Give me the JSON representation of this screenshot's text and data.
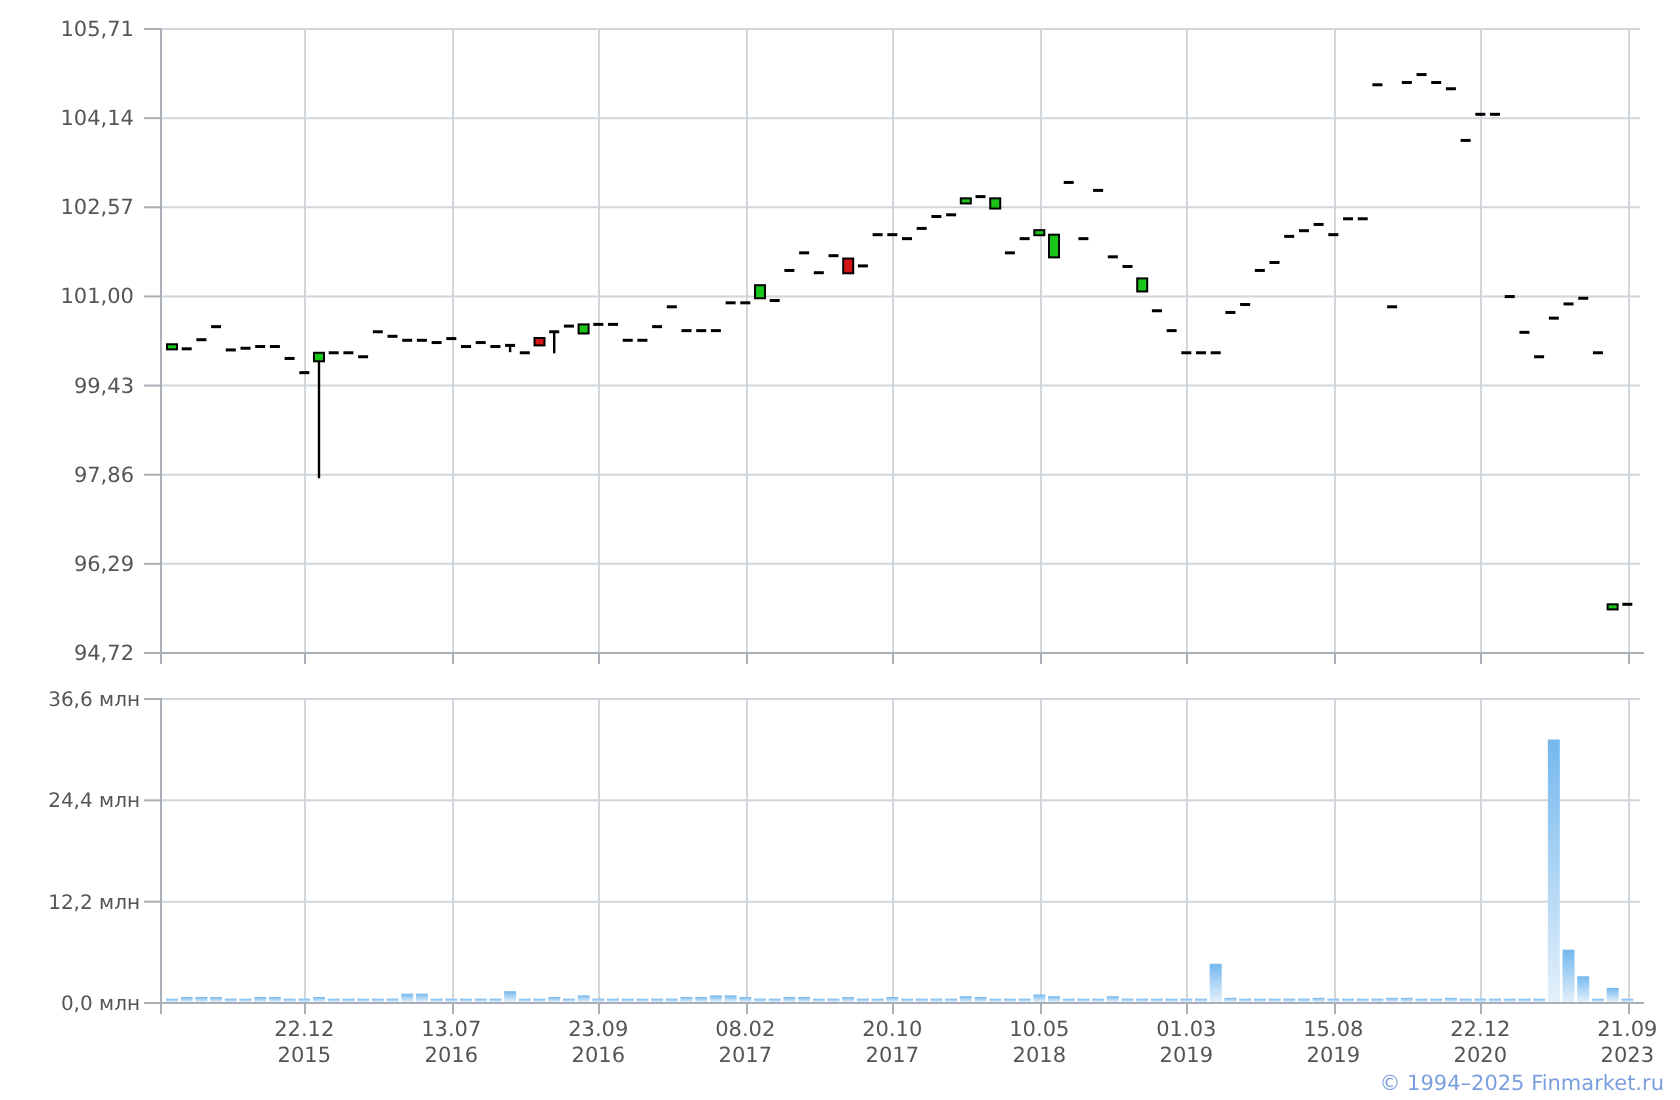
{
  "price_chart": {
    "chart_data": {
      "type": "candlestick",
      "grid": true,
      "categories": [
        null,
        null,
        null,
        null,
        null,
        null,
        null,
        null,
        null,
        null,
        null,
        null,
        null,
        null,
        null,
        null,
        null,
        null,
        null,
        null,
        null,
        null,
        null,
        null,
        null,
        null,
        null,
        null,
        null,
        null,
        null,
        null,
        null,
        null,
        null,
        null,
        null,
        null,
        null,
        null,
        null,
        null,
        null,
        null,
        null,
        null,
        null,
        null,
        null,
        null,
        null,
        null,
        null,
        null,
        null,
        null,
        null,
        null,
        null,
        null,
        null,
        null,
        null,
        null,
        null,
        null,
        null,
        null,
        null,
        null,
        null,
        null,
        null,
        null,
        null,
        null,
        null,
        null,
        null,
        null,
        null,
        null,
        null,
        null,
        null,
        null,
        null,
        null,
        null,
        null,
        null,
        null,
        null,
        null,
        null,
        null,
        null,
        null,
        null,
        null
      ],
      "ylim": [
        94.72,
        105.71
      ],
      "yticks": [
        {
          "value": 94.72,
          "label": "94,72"
        },
        {
          "value": 96.29,
          "label": "96,29"
        },
        {
          "value": 97.86,
          "label": "97,86"
        },
        {
          "value": 99.43,
          "label": "99,43"
        },
        {
          "value": 101.0,
          "label": "101,00"
        },
        {
          "value": 102.57,
          "label": "102,57"
        },
        {
          "value": 104.14,
          "label": "104,14"
        },
        {
          "value": 105.71,
          "label": "105,71"
        }
      ],
      "ohlc": [
        [
          100.05,
          100.14,
          100.05,
          100.14
        ],
        [
          100.06,
          100.06,
          100.06,
          100.06
        ],
        [
          100.22,
          100.22,
          100.22,
          100.22
        ],
        [
          100.45,
          100.45,
          100.45,
          100.45
        ],
        [
          100.04,
          100.04,
          100.04,
          100.04
        ],
        [
          100.07,
          100.07,
          100.07,
          100.07
        ],
        [
          100.1,
          100.1,
          100.1,
          100.1
        ],
        [
          100.1,
          100.1,
          100.1,
          100.1
        ],
        [
          99.89,
          99.89,
          99.89,
          99.89
        ],
        [
          99.64,
          99.64,
          99.64,
          99.64
        ],
        [
          99.84,
          99.99,
          97.78,
          99.99
        ],
        [
          99.99,
          99.99,
          99.99,
          99.99
        ],
        [
          99.99,
          99.99,
          99.99,
          99.99
        ],
        [
          99.92,
          99.92,
          99.92,
          99.92
        ],
        [
          100.36,
          100.36,
          100.36,
          100.36
        ],
        [
          100.28,
          100.28,
          100.28,
          100.28
        ],
        [
          100.21,
          100.21,
          100.21,
          100.21
        ],
        [
          100.21,
          100.21,
          100.21,
          100.21
        ],
        [
          100.17,
          100.17,
          100.17,
          100.17
        ],
        [
          100.24,
          100.24,
          100.24,
          100.24
        ],
        [
          100.1,
          100.1,
          100.1,
          100.1
        ],
        [
          100.17,
          100.17,
          100.17,
          100.17
        ],
        [
          100.1,
          100.1,
          100.1,
          100.1
        ],
        [
          100.12,
          100.12,
          100.0,
          100.12
        ],
        [
          99.99,
          99.99,
          99.99,
          99.99
        ],
        [
          100.25,
          100.25,
          100.12,
          100.12
        ],
        [
          100.36,
          100.36,
          99.98,
          100.36
        ],
        [
          100.46,
          100.46,
          100.46,
          100.46
        ],
        [
          100.33,
          100.49,
          100.33,
          100.49
        ],
        [
          100.49,
          100.49,
          100.49,
          100.49
        ],
        [
          100.49,
          100.49,
          100.49,
          100.49
        ],
        [
          100.21,
          100.21,
          100.21,
          100.21
        ],
        [
          100.21,
          100.21,
          100.21,
          100.21
        ],
        [
          100.45,
          100.45,
          100.45,
          100.45
        ],
        [
          100.8,
          100.8,
          100.8,
          100.8
        ],
        [
          100.38,
          100.38,
          100.38,
          100.38
        ],
        [
          100.38,
          100.38,
          100.38,
          100.38
        ],
        [
          100.38,
          100.38,
          100.38,
          100.38
        ],
        [
          100.87,
          100.87,
          100.87,
          100.87
        ],
        [
          100.87,
          100.87,
          100.87,
          100.87
        ],
        [
          100.95,
          101.18,
          100.95,
          101.18
        ],
        [
          100.91,
          100.91,
          100.91,
          100.91
        ],
        [
          101.44,
          101.44,
          101.44,
          101.44
        ],
        [
          101.75,
          101.75,
          101.75,
          101.75
        ],
        [
          101.4,
          101.4,
          101.4,
          101.4
        ],
        [
          101.7,
          101.7,
          101.7,
          101.7
        ],
        [
          101.65,
          101.65,
          101.39,
          101.39
        ],
        [
          101.52,
          101.52,
          101.52,
          101.52
        ],
        [
          102.07,
          102.07,
          102.07,
          102.07
        ],
        [
          102.07,
          102.07,
          102.07,
          102.07
        ],
        [
          102.0,
          102.0,
          102.0,
          102.0
        ],
        [
          102.18,
          102.18,
          102.18,
          102.18
        ],
        [
          102.39,
          102.39,
          102.39,
          102.39
        ],
        [
          102.42,
          102.42,
          102.42,
          102.42
        ],
        [
          102.62,
          102.71,
          102.62,
          102.71
        ],
        [
          102.74,
          102.74,
          102.74,
          102.74
        ],
        [
          102.53,
          102.71,
          102.53,
          102.71
        ],
        [
          101.75,
          101.75,
          101.75,
          101.75
        ],
        [
          102.0,
          102.0,
          102.0,
          102.0
        ],
        [
          102.06,
          102.15,
          102.06,
          102.15
        ],
        [
          101.67,
          102.07,
          101.67,
          102.07
        ],
        [
          102.99,
          102.99,
          102.99,
          102.99
        ],
        [
          102.0,
          102.0,
          102.0,
          102.0
        ],
        [
          102.85,
          102.85,
          102.85,
          102.85
        ],
        [
          101.68,
          101.68,
          101.68,
          101.68
        ],
        [
          101.51,
          101.51,
          101.51,
          101.51
        ],
        [
          101.07,
          101.3,
          101.07,
          101.3
        ],
        [
          100.73,
          100.73,
          100.73,
          100.73
        ],
        [
          100.38,
          100.38,
          100.38,
          100.38
        ],
        [
          99.99,
          99.99,
          99.99,
          99.99
        ],
        [
          99.99,
          99.99,
          99.99,
          99.99
        ],
        [
          99.99,
          99.99,
          99.99,
          99.99
        ],
        [
          100.7,
          100.7,
          100.7,
          100.7
        ],
        [
          100.84,
          100.84,
          100.84,
          100.84
        ],
        [
          101.44,
          101.44,
          101.44,
          101.44
        ],
        [
          101.58,
          101.58,
          101.58,
          101.58
        ],
        [
          102.04,
          102.04,
          102.04,
          102.04
        ],
        [
          102.14,
          102.14,
          102.14,
          102.14
        ],
        [
          102.25,
          102.25,
          102.25,
          102.25
        ],
        [
          102.07,
          102.07,
          102.07,
          102.07
        ],
        [
          102.35,
          102.35,
          102.35,
          102.35
        ],
        [
          102.35,
          102.35,
          102.35,
          102.35
        ],
        [
          104.71,
          104.71,
          104.71,
          104.71
        ],
        [
          100.8,
          100.8,
          100.8,
          100.8
        ],
        [
          104.75,
          104.75,
          104.75,
          104.75
        ],
        [
          104.89,
          104.89,
          104.89,
          104.89
        ],
        [
          104.75,
          104.75,
          104.75,
          104.75
        ],
        [
          104.64,
          104.64,
          104.64,
          104.64
        ],
        [
          103.73,
          103.73,
          103.73,
          103.73
        ],
        [
          104.19,
          104.19,
          104.19,
          104.19
        ],
        [
          104.19,
          104.19,
          104.19,
          104.19
        ],
        [
          100.98,
          100.98,
          100.98,
          100.98
        ],
        [
          100.35,
          100.35,
          100.35,
          100.35
        ],
        [
          99.92,
          99.92,
          99.92,
          99.92
        ],
        [
          100.6,
          100.6,
          100.6,
          100.6
        ],
        [
          100.85,
          100.85,
          100.85,
          100.85
        ],
        [
          100.95,
          100.95,
          100.95,
          100.95
        ],
        [
          99.99,
          99.99,
          99.99,
          99.99
        ],
        [
          95.47,
          95.56,
          95.47,
          95.56
        ],
        [
          95.56,
          95.56,
          95.56,
          95.56
        ]
      ]
    }
  },
  "volume_chart": {
    "chart_data": {
      "type": "bar",
      "grid": true,
      "ylim": [
        0,
        36.6
      ],
      "categories": [
        null,
        null,
        null,
        null,
        null,
        null,
        null,
        null,
        null,
        "22.12\n2015",
        null,
        null,
        null,
        null,
        null,
        null,
        null,
        null,
        null,
        "13.07\n2016",
        null,
        null,
        null,
        null,
        null,
        null,
        null,
        null,
        null,
        "23.09\n2016",
        null,
        null,
        null,
        null,
        null,
        null,
        null,
        null,
        null,
        "08.02\n2017",
        null,
        null,
        null,
        null,
        null,
        null,
        null,
        null,
        null,
        "20.10\n2017",
        null,
        null,
        null,
        null,
        null,
        null,
        null,
        null,
        null,
        "10.05\n2018",
        null,
        null,
        null,
        null,
        null,
        null,
        null,
        null,
        null,
        "01.03\n2019",
        null,
        null,
        null,
        null,
        null,
        null,
        null,
        null,
        null,
        "15.08\n2019",
        null,
        null,
        null,
        null,
        null,
        null,
        null,
        null,
        null,
        "22.12\n2020",
        null,
        null,
        null,
        null,
        null,
        null,
        null,
        null,
        null,
        "21.09\n2023"
      ],
      "yticks": [
        {
          "value": 0,
          "label": "0,0 млн"
        },
        {
          "value": 12.2,
          "label": "12,2 млн"
        },
        {
          "value": 24.4,
          "label": "24,4 млн"
        },
        {
          "value": 36.6,
          "label": "36,6 млн"
        }
      ],
      "series": [
        {
          "color": "#74b8ee",
          "values": [
            0.4,
            0.6,
            0.6,
            0.6,
            0.4,
            0.4,
            0.6,
            0.6,
            0.4,
            0.4,
            0.6,
            0.4,
            0.4,
            0.4,
            0.4,
            0.4,
            1.0,
            1.0,
            0.4,
            0.4,
            0.4,
            0.4,
            0.4,
            1.3,
            0.4,
            0.4,
            0.6,
            0.4,
            0.8,
            0.4,
            0.4,
            0.4,
            0.4,
            0.4,
            0.4,
            0.6,
            0.6,
            0.8,
            0.8,
            0.6,
            0.4,
            0.4,
            0.6,
            0.6,
            0.4,
            0.4,
            0.6,
            0.4,
            0.4,
            0.6,
            0.4,
            0.4,
            0.4,
            0.4,
            0.7,
            0.6,
            0.4,
            0.4,
            0.4,
            0.9,
            0.7,
            0.4,
            0.4,
            0.4,
            0.7,
            0.4,
            0.4,
            0.4,
            0.4,
            0.4,
            0.4,
            4.6,
            0.5,
            0.4,
            0.4,
            0.4,
            0.4,
            0.4,
            0.5,
            0.4,
            0.4,
            0.4,
            0.4,
            0.5,
            0.5,
            0.4,
            0.4,
            0.5,
            0.4,
            0.4,
            0.4,
            0.4,
            0.4,
            0.4,
            31.6,
            6.3,
            3.1,
            0.4,
            1.7,
            0.4
          ]
        }
      ]
    }
  },
  "copyright": "© 1994–2025 Finmarket.ru"
}
